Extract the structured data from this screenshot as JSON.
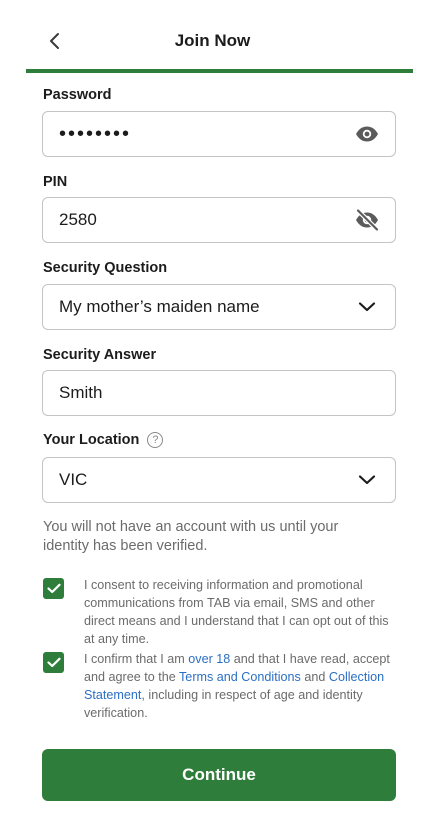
{
  "header": {
    "title": "Join Now"
  },
  "password": {
    "label": "Password",
    "value": "••••••••"
  },
  "pin": {
    "label": "PIN",
    "value": "2580"
  },
  "security_question": {
    "label": "Security Question",
    "value": "My mother’s maiden name"
  },
  "security_answer": {
    "label": "Security Answer",
    "value": "Smith"
  },
  "location": {
    "label": "Your Location",
    "help": "?",
    "value": "VIC"
  },
  "notice": "You will not have an account with us until your identity has been verified.",
  "consent": {
    "text": "I consent to receiving information and promotional communications from TAB via email, SMS and other direct means and I understand that I can opt out of this at any time.",
    "checked": true
  },
  "confirm": {
    "part1": "I confirm that I am ",
    "link_age": "over 18",
    "part2": " and that I have read, accept and agree to the ",
    "link_terms": "Terms and Conditions",
    "part3": " and ",
    "link_collection": "Collection Statement",
    "part4": ", including in respect of age and identity verification.",
    "checked": true
  },
  "continue_label": "Continue",
  "colors": {
    "brand_green": "#2f7d3a",
    "link_blue": "#2b6fc4"
  }
}
